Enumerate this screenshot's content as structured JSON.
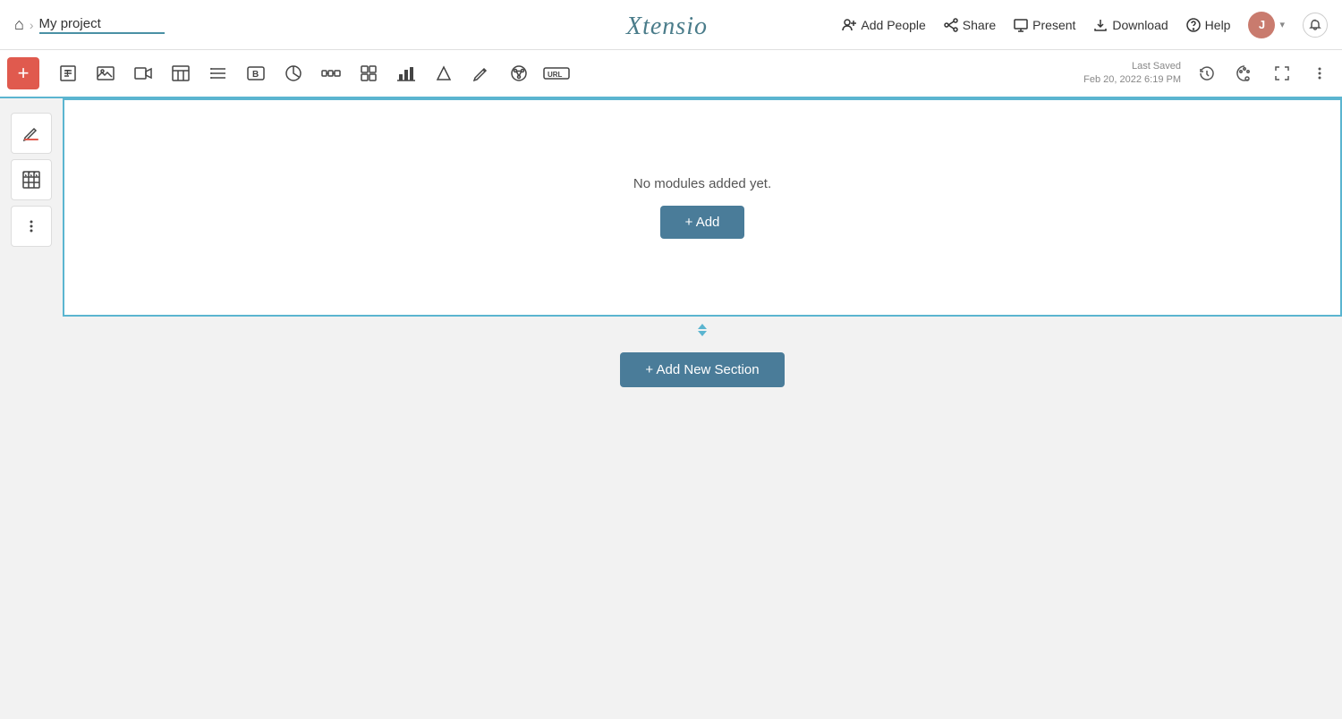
{
  "nav": {
    "home_icon": "🏠",
    "chevron": "›",
    "project_title": "My project",
    "logo": "Xtensio",
    "add_people_label": "Add People",
    "share_label": "Share",
    "present_label": "Present",
    "download_label": "Download",
    "help_label": "Help",
    "avatar_initials": "J",
    "avatar_chevron": "▾"
  },
  "toolbar": {
    "add_btn_label": "+",
    "last_saved_label": "Last Saved",
    "last_saved_date": "Feb 20, 2022 6:19 PM",
    "tools": [
      {
        "name": "text-tool",
        "icon": "T",
        "title": "Text"
      },
      {
        "name": "image-tool",
        "icon": "🖼",
        "title": "Image"
      },
      {
        "name": "video-tool",
        "icon": "▶",
        "title": "Video"
      },
      {
        "name": "table-tool",
        "icon": "⊞",
        "title": "Table"
      },
      {
        "name": "list-tool",
        "icon": "≡",
        "title": "List"
      },
      {
        "name": "button-tool",
        "icon": "B",
        "title": "Button"
      },
      {
        "name": "chart-pie-tool",
        "icon": "◑",
        "title": "Pie Chart"
      },
      {
        "name": "process-tool",
        "icon": "⇌",
        "title": "Process"
      },
      {
        "name": "layers-tool",
        "icon": "≡",
        "title": "Layers"
      },
      {
        "name": "bar-chart-tool",
        "icon": "▌",
        "title": "Bar Chart"
      },
      {
        "name": "shape-tool",
        "icon": "◻",
        "title": "Shape"
      },
      {
        "name": "signature-tool",
        "icon": "✎",
        "title": "Signature"
      },
      {
        "name": "social-tool",
        "icon": "❊",
        "title": "Social"
      },
      {
        "name": "url-tool",
        "icon": "URL",
        "title": "URL"
      }
    ],
    "right_icons": [
      {
        "name": "history-icon",
        "icon": "↺",
        "title": "History"
      },
      {
        "name": "palette-icon",
        "icon": "◈",
        "title": "Palette"
      },
      {
        "name": "fullscreen-icon",
        "icon": "⤢",
        "title": "Fullscreen"
      },
      {
        "name": "more-icon",
        "icon": "⋮",
        "title": "More"
      }
    ]
  },
  "left_panel": {
    "icons": [
      {
        "name": "fill-icon",
        "icon": "◈",
        "title": "Fill"
      },
      {
        "name": "pattern-icon",
        "icon": "▦",
        "title": "Pattern"
      },
      {
        "name": "more-options-icon",
        "icon": "⋮",
        "title": "More Options"
      }
    ]
  },
  "section": {
    "no_modules_text": "No modules added yet.",
    "add_module_label": "+ Add"
  },
  "divider": {
    "up_arrow": "▲",
    "down_arrow": "▼"
  },
  "add_section": {
    "label": "+ Add New Section"
  },
  "colors": {
    "accent": "#5bb5d0",
    "brand": "#4a7c99",
    "add_btn": "#e05a4e",
    "avatar": "#c97b6e"
  }
}
